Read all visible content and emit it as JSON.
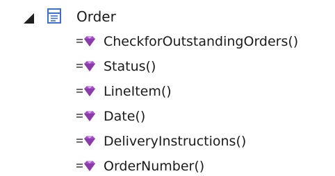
{
  "tree": {
    "root": {
      "label": "Order",
      "icon": "class-icon",
      "expander_icon": "expanded-triangle-icon",
      "expanded": true
    },
    "operations": [
      {
        "label": "CheckforOutstandingOrders()",
        "icon": "operation-icon"
      },
      {
        "label": "Status()",
        "icon": "operation-icon"
      },
      {
        "label": "LineItem()",
        "icon": "operation-icon"
      },
      {
        "label": "Date()",
        "icon": "operation-icon"
      },
      {
        "label": "DeliveryInstructions()",
        "icon": "operation-icon"
      },
      {
        "label": "OrderNumber()",
        "icon": "operation-icon"
      }
    ]
  },
  "colors": {
    "class_icon": "#3a6fd8",
    "operation_gem": "#a552c4",
    "operation_lines": "#4a4a4a",
    "text": "#1a1a1a"
  }
}
